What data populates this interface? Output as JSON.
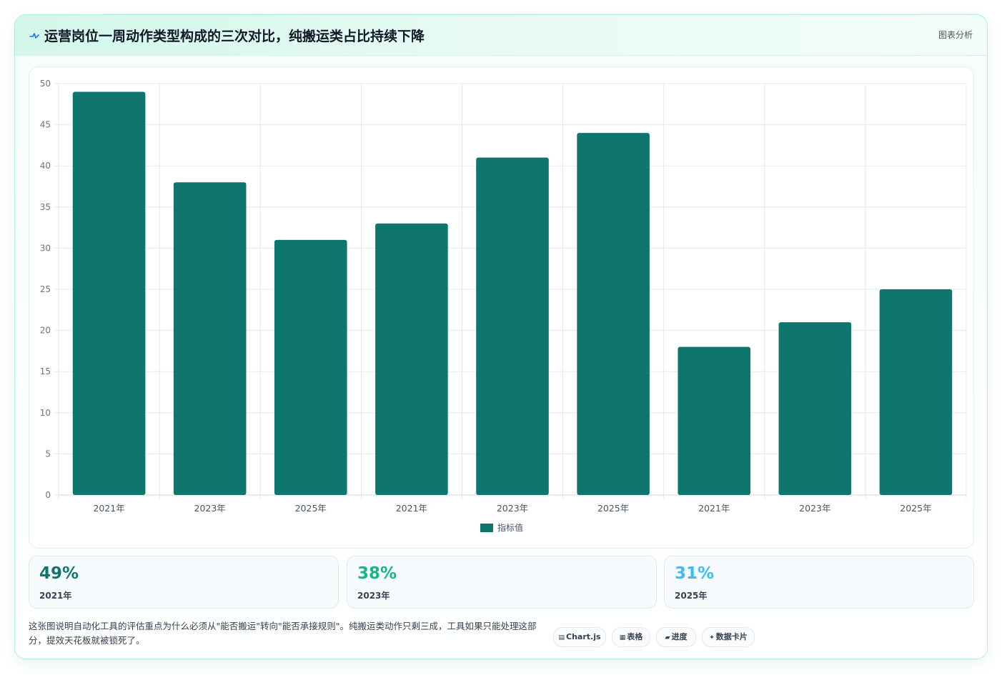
{
  "header": {
    "title": "运营岗位一周动作类型构成的三次对比，纯搬运类占比持续下降",
    "tag": "图表分析",
    "icon": "pulse-icon"
  },
  "chart_data": {
    "type": "bar",
    "categories": [
      "2021年",
      "2023年",
      "2025年",
      "2021年",
      "2023年",
      "2025年",
      "2021年",
      "2023年",
      "2025年"
    ],
    "series": [
      {
        "name": "指标值",
        "values": [
          49,
          38,
          31,
          33,
          41,
          44,
          18,
          21,
          25
        ]
      }
    ],
    "ylim": [
      0,
      50
    ],
    "yticks": [
      0,
      5,
      10,
      15,
      20,
      25,
      30,
      35,
      40,
      45,
      50
    ],
    "grid": true,
    "legend": "bottom-center",
    "colors": {
      "bar": "#0f766e",
      "grid": "#e5e7eb",
      "axis_text": "#6b7280"
    }
  },
  "stats": [
    {
      "value": "49%",
      "label": "2021年",
      "color": "#0f766e"
    },
    {
      "value": "38%",
      "label": "2023年",
      "color": "#10b981"
    },
    {
      "value": "31%",
      "label": "2025年",
      "color": "#38bdf8"
    }
  ],
  "note": "这张图说明自动化工具的评估重点为什么必须从\"能否搬运\"转向\"能否承接规则\"。纯搬运类动作只剩三成，工具如果只能处理这部分，提效天花板就被锁死了。",
  "pills": [
    {
      "icon": "▤",
      "label": "Chart.js",
      "icon_name": "chart-icon"
    },
    {
      "icon": "▦",
      "label": "表格",
      "icon_name": "table-icon"
    },
    {
      "icon": "▰",
      "label": "进度",
      "icon_name": "progress-icon"
    },
    {
      "icon": "✦",
      "label": "数据卡片",
      "icon_name": "sparkle-icon"
    }
  ]
}
